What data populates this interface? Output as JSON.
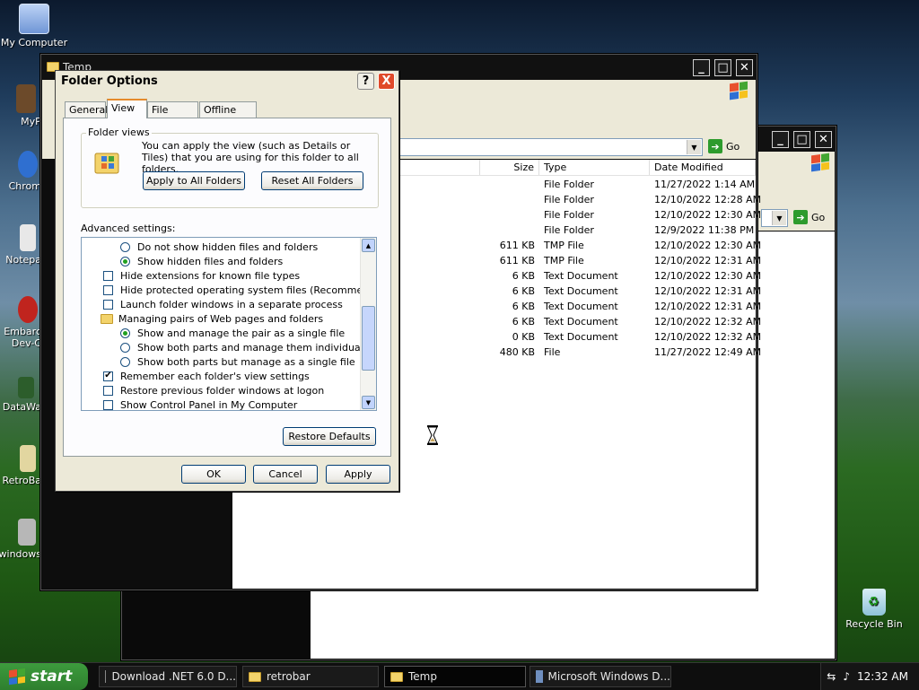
{
  "desktop": {
    "icons": [
      {
        "label": "My Computer"
      },
      {
        "label": "MyPa"
      },
      {
        "label": "Chrom"
      },
      {
        "label": "Notepa"
      },
      {
        "label": "Embarc"
      },
      {
        "label": "Dev-C"
      },
      {
        "label": "DataWa"
      },
      {
        "label": "RetroBa"
      },
      {
        "label": "windows"
      },
      {
        "label": "Recycle Bin"
      }
    ]
  },
  "explorer_front": {
    "title": "Temp",
    "go_label": "Go",
    "columns": [
      "Size",
      "Type",
      "Date Modified"
    ],
    "rows": [
      {
        "size": "",
        "type": "File Folder",
        "date": "11/27/2022 1:14 AM"
      },
      {
        "size": "",
        "type": "File Folder",
        "date": "12/10/2022 12:28 AM"
      },
      {
        "size": "",
        "type": "File Folder",
        "date": "12/10/2022 12:30 AM"
      },
      {
        "size": "",
        "type": "File Folder",
        "date": "12/9/2022 11:38 PM"
      },
      {
        "size": "611 KB",
        "type": "TMP File",
        "date": "12/10/2022 12:30 AM"
      },
      {
        "size": "611 KB",
        "type": "TMP File",
        "date": "12/10/2022 12:31 AM"
      },
      {
        "size": "6 KB",
        "type": "Text Document",
        "date": "12/10/2022 12:30 AM"
      },
      {
        "size": "6 KB",
        "type": "Text Document",
        "date": "12/10/2022 12:31 AM"
      },
      {
        "size": "6 KB",
        "type": "Text Document",
        "date": "12/10/2022 12:31 AM"
      },
      {
        "size": "6 KB",
        "type": "Text Document",
        "date": "12/10/2022 12:32 AM"
      },
      {
        "size": "0 KB",
        "type": "Text Document",
        "date": "12/10/2022 12:32 AM"
      },
      {
        "size": "480 KB",
        "type": "File",
        "date": "11/27/2022 12:49 AM"
      }
    ]
  },
  "explorer_back": {
    "go_label": "Go"
  },
  "dialog": {
    "title": "Folder Options",
    "help": "?",
    "close": "X",
    "tabs": [
      "General",
      "View",
      "File Types",
      "Offline Files"
    ],
    "folder_views_legend": "Folder views",
    "folder_views_text": "You can apply the view (such as Details or Tiles) that you are using for this folder to all folders.",
    "apply_all_label": "Apply to All Folders",
    "reset_all_label": "Reset All Folders",
    "advanced_label": "Advanced settings:",
    "items": [
      {
        "text": "Do not show hidden files and folders",
        "kind": "radio",
        "checked": false,
        "indent": 2
      },
      {
        "text": "Show hidden files and folders",
        "kind": "radio",
        "checked": true,
        "indent": 2
      },
      {
        "text": "Hide extensions for known file types",
        "kind": "check",
        "checked": false,
        "indent": 1
      },
      {
        "text": "Hide protected operating system files (Recommended)",
        "kind": "check",
        "checked": false,
        "indent": 1
      },
      {
        "text": "Launch folder windows in a separate process",
        "kind": "check",
        "checked": false,
        "indent": 1
      },
      {
        "text": "Managing pairs of Web pages and folders",
        "kind": "folder",
        "checked": false,
        "indent": 1
      },
      {
        "text": "Show and manage the pair as a single file",
        "kind": "radio",
        "checked": true,
        "indent": 2
      },
      {
        "text": "Show both parts and manage them individually",
        "kind": "radio",
        "checked": false,
        "indent": 2
      },
      {
        "text": "Show both parts but manage as a single file",
        "kind": "radio",
        "checked": false,
        "indent": 2
      },
      {
        "text": "Remember each folder's view settings",
        "kind": "check",
        "checked": true,
        "indent": 1
      },
      {
        "text": "Restore previous folder windows at logon",
        "kind": "check",
        "checked": false,
        "indent": 1
      },
      {
        "text": "Show Control Panel in My Computer",
        "kind": "check",
        "checked": false,
        "indent": 1
      }
    ],
    "restore_defaults_label": "Restore Defaults",
    "ok_label": "OK",
    "cancel_label": "Cancel",
    "apply_label": "Apply"
  },
  "taskbar": {
    "start_label": "start",
    "tasks": [
      {
        "label": "Download .NET 6.0 D..."
      },
      {
        "label": "retrobar"
      },
      {
        "label": "Temp"
      },
      {
        "label": "Microsoft Windows D..."
      }
    ],
    "clock": "12:32 AM"
  },
  "colors": {
    "accent_green": "#2e7f2e",
    "dialog_bg": "#ece9d8",
    "close_red": "#e04a2a",
    "radio_dot": "#21a121"
  }
}
